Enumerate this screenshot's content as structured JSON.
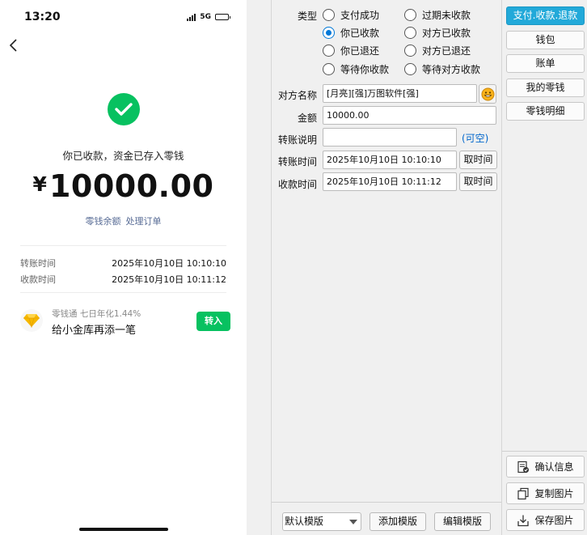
{
  "phone": {
    "status_time": "13:20",
    "network": "5G",
    "battery_level": 0.6,
    "message": "你已收款，资金已存入零钱",
    "currency_symbol": "¥",
    "amount": "10000.00",
    "link_balance": "零钱余额",
    "link_order": "处理订单",
    "transfer_time_label": "转账时间",
    "transfer_time_value": "2025年10月10日 10:10:10",
    "receive_time_label": "收款时间",
    "receive_time_value": "2025年10月10日 10:11:12",
    "promo_sub": "零钱通 七日年化1.44%",
    "promo_main": "给小金库再添一笔",
    "promo_button": "转入",
    "brand_green": "#07c160"
  },
  "form": {
    "type_label": "类型",
    "radios": [
      {
        "label": "支付成功",
        "checked": false
      },
      {
        "label": "过期未收款",
        "checked": false
      },
      {
        "label": "你已收款",
        "checked": true
      },
      {
        "label": "对方已收款",
        "checked": false
      },
      {
        "label": "你已退还",
        "checked": false
      },
      {
        "label": "对方已退还",
        "checked": false
      },
      {
        "label": "等待你收款",
        "checked": false
      },
      {
        "label": "等待对方收款",
        "checked": false
      }
    ],
    "counterparty_label": "对方名称",
    "counterparty_value": "[月亮][强]万图软件[强]",
    "amount_label": "金额",
    "amount_value": "10000.00",
    "note_label": "转账说明",
    "note_value": "",
    "note_hint": "(可空)",
    "transfer_time_label": "转账时间",
    "transfer_time_value": "2025年10月10日  10:10:10",
    "receive_time_label": "收款时间",
    "receive_time_value": "2025年10月10日  10:11:12",
    "get_time_button": "取时间",
    "template_select": "默认模版",
    "add_template_button": "添加模版",
    "edit_template_button": "编辑模版",
    "accent": "#0078d7"
  },
  "sidebar": {
    "nav": [
      {
        "label": "支付.收款.退款",
        "active": true
      },
      {
        "label": "钱包",
        "active": false
      },
      {
        "label": "账单",
        "active": false
      },
      {
        "label": "我的零钱",
        "active": false
      },
      {
        "label": "零钱明细",
        "active": false
      }
    ],
    "actions": [
      {
        "label": "确认信息",
        "icon": "confirm-doc-icon"
      },
      {
        "label": "复制图片",
        "icon": "copy-icon"
      },
      {
        "label": "保存图片",
        "icon": "save-download-icon"
      }
    ],
    "active_color": "#22a9d9"
  }
}
